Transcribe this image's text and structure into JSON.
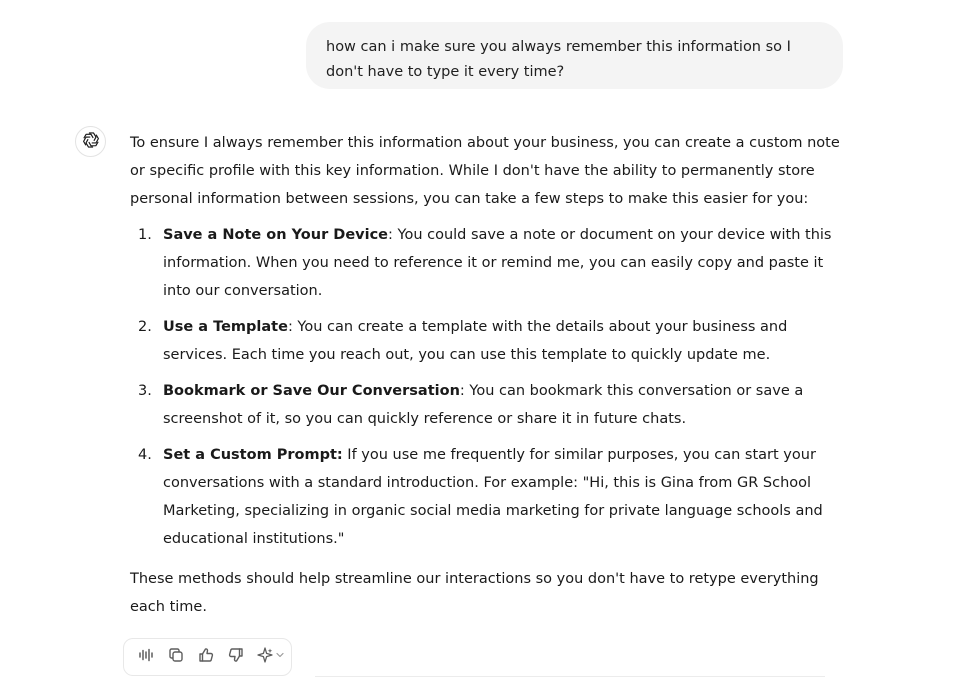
{
  "user_message": {
    "text": "how can i make sure you always remember this information so I don't have to type it every time?"
  },
  "assistant": {
    "avatar_icon": "openai-logo-icon",
    "intro": "To ensure I always remember this information about your business, you can create a custom note or specific profile with this key information. While I don't have the ability to permanently store personal information between sessions, you can take a few steps to make this easier for you:",
    "steps": [
      {
        "number": "1.",
        "title": "Save a Note on Your Device",
        "body": ": You could save a note or document on your device with this information. When you need to reference it or remind me, you can easily copy and paste it into our conversation."
      },
      {
        "number": "2.",
        "title": "Use a Template",
        "body": ": You can create a template with the details about your business and services. Each time you reach out, you can use this template to quickly update me."
      },
      {
        "number": "3.",
        "title": "Bookmark or Save Our Conversation",
        "body": ": You can bookmark this conversation or save a screenshot of it, so you can quickly reference or share it in future chats."
      },
      {
        "number": "4.",
        "title": "Set a Custom Prompt:",
        "body": " If you use me frequently for similar purposes, you can start your conversations with a standard introduction. For example: \"Hi, this is Gina from GR School Marketing, specializing in organic social media marketing for private language schools and educational institutions.\""
      }
    ],
    "closing": "These methods should help streamline our interactions so you don't have to retype everything each time."
  },
  "actions": {
    "icons": [
      "read-aloud-icon",
      "copy-icon",
      "thumbs-up-icon",
      "thumbs-down-icon",
      "sparkle-model-icon"
    ]
  },
  "colors": {
    "bubble_bg": "#f4f4f4",
    "text": "#1a1a1a",
    "icon": "#5d5d5d",
    "border": "#e8e8e8"
  }
}
